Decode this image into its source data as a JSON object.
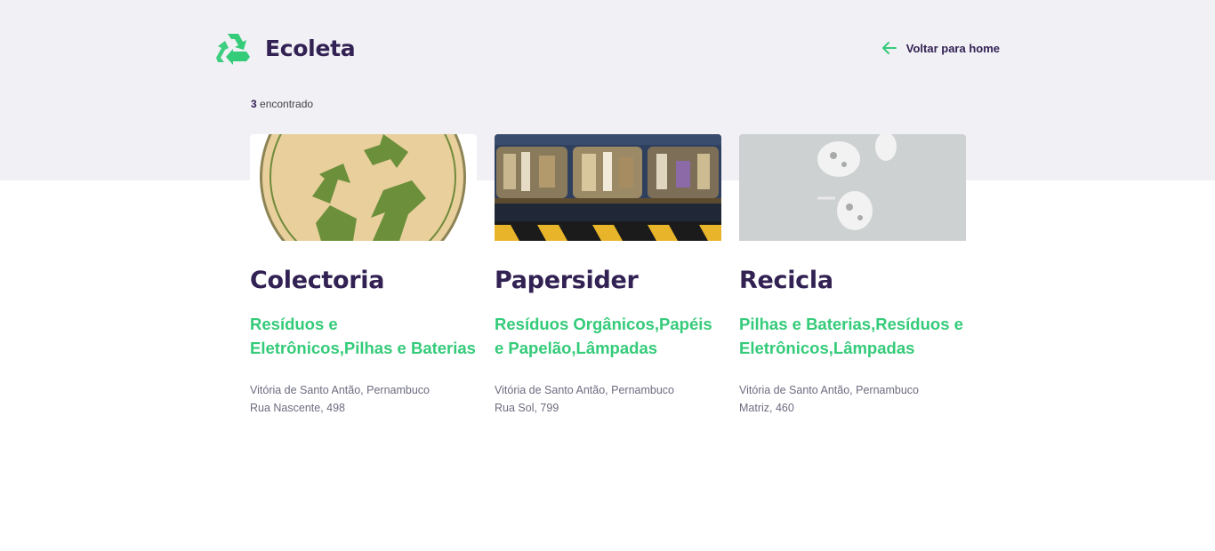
{
  "header": {
    "app_name": "Ecoleta",
    "back_label": "Voltar para home",
    "logo_icon": "recycle-icon",
    "back_icon": "arrow-left-icon"
  },
  "results": {
    "count": "3",
    "label": "encontrado"
  },
  "colors": {
    "brand_dark": "#322153",
    "brand_green": "#34cb79",
    "top_band": "#f0f0f5",
    "text_muted": "#6c6c80"
  },
  "points": [
    {
      "name": "Colectoria",
      "items": "Resíduos e Eletrônicos,Pilhas e Baterias",
      "city": "Vitória de Santo Antão, Pernambuco",
      "street": "Rua Nascente, 498"
    },
    {
      "name": "Papersider",
      "items": "Resíduos Orgânicos,Papéis e Papelão,Lâmpadas",
      "city": "Vitória de Santo Antão, Pernambuco",
      "street": "Rua Sol, 799"
    },
    {
      "name": "Recicla",
      "items": "Pilhas e Baterias,Resíduos e Eletrônicos,Lâmpadas",
      "city": "Vitória de Santo Antão, Pernambuco",
      "street": "Matriz, 460"
    }
  ]
}
